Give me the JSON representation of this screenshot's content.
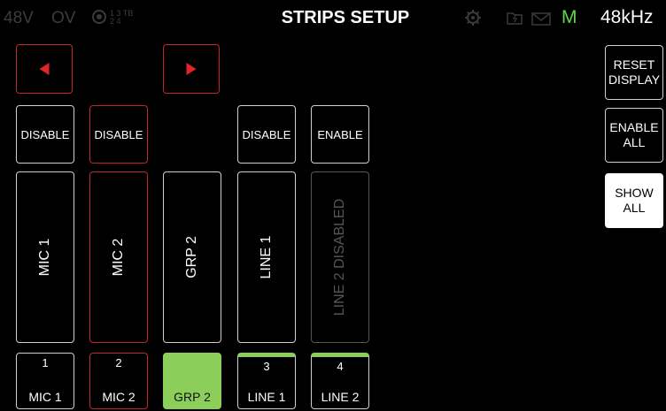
{
  "status_bar": {
    "phantom": "48V",
    "overload": "OV",
    "io_small": "1 3 TB\n2 4",
    "title": "STRIPS SETUP",
    "master": "M",
    "sample_rate": "48kHz"
  },
  "nav": {
    "left_icon": "arrow-left-icon",
    "right_icon": "arrow-right-icon"
  },
  "toggles": [
    {
      "label": "DISABLE"
    },
    {
      "label": "DISABLE"
    },
    {
      "label": "DISABLE"
    },
    {
      "label": "ENABLE"
    }
  ],
  "strips": [
    {
      "label": "MIC 1"
    },
    {
      "label": "MIC 2"
    },
    {
      "label": "GRP 2"
    },
    {
      "label": "LINE 1"
    },
    {
      "label": "LINE 2 DISABLED"
    }
  ],
  "channels": [
    {
      "number": "1",
      "label": "MIC 1"
    },
    {
      "number": "2",
      "label": "MIC 2"
    },
    {
      "number": "",
      "label": "GRP 2"
    },
    {
      "number": "3",
      "label": "LINE 1"
    },
    {
      "number": "4",
      "label": "LINE 2"
    }
  ],
  "side": {
    "reset": [
      "RESET",
      "DISPLAY"
    ],
    "enable_all": [
      "ENABLE",
      "ALL"
    ],
    "show_all": [
      "SHOW",
      "ALL"
    ]
  },
  "colors": {
    "accent_red": "#c0282a",
    "accent_green": "#8bcf5a",
    "master_green": "#5fd84a"
  }
}
